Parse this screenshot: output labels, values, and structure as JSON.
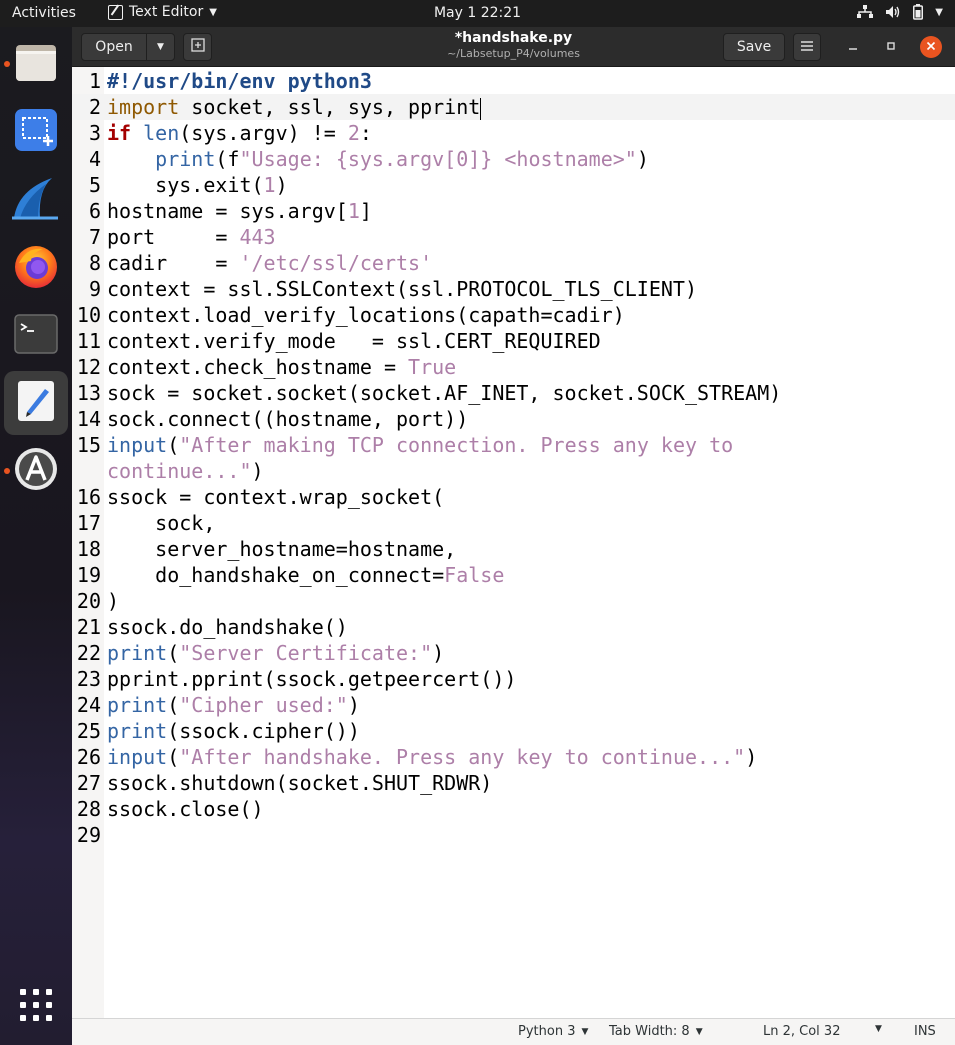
{
  "topbar": {
    "activities": "Activities",
    "app_name": "Text Editor",
    "clock": "May 1  22:21"
  },
  "headerbar": {
    "open_label": "Open",
    "save_label": "Save",
    "title": "*handshake.py",
    "path": "~/Labsetup_P4/volumes"
  },
  "editor": {
    "current_line": 2,
    "lines": [
      {
        "n": "1",
        "tokens": [
          [
            "comment",
            "#!/usr/bin/env python3"
          ]
        ]
      },
      {
        "n": "2",
        "tokens": [
          [
            "import",
            "import"
          ],
          [
            "plain",
            " socket, ssl, sys, pprint"
          ]
        ]
      },
      {
        "n": "3",
        "tokens": [
          [
            "kw",
            "if"
          ],
          [
            "plain",
            " "
          ],
          [
            "builtin",
            "len"
          ],
          [
            "plain",
            "(sys.argv) != "
          ],
          [
            "num",
            "2"
          ],
          [
            "plain",
            ":"
          ]
        ]
      },
      {
        "n": "4",
        "tokens": [
          [
            "plain",
            "    "
          ],
          [
            "builtin",
            "print"
          ],
          [
            "plain",
            "(f"
          ],
          [
            "str",
            "\"Usage: {sys.argv[0]} <hostname>\""
          ],
          [
            "plain",
            ")"
          ]
        ]
      },
      {
        "n": "5",
        "tokens": [
          [
            "plain",
            "    sys.exit("
          ],
          [
            "num",
            "1"
          ],
          [
            "plain",
            ")"
          ]
        ]
      },
      {
        "n": "6",
        "tokens": [
          [
            "plain",
            "hostname = sys.argv["
          ],
          [
            "num",
            "1"
          ],
          [
            "plain",
            "]"
          ]
        ]
      },
      {
        "n": "7",
        "tokens": [
          [
            "plain",
            "port     = "
          ],
          [
            "num",
            "443"
          ]
        ]
      },
      {
        "n": "8",
        "tokens": [
          [
            "plain",
            "cadir    = "
          ],
          [
            "str",
            "'/etc/ssl/certs'"
          ]
        ]
      },
      {
        "n": "9",
        "tokens": [
          [
            "plain",
            "context = ssl.SSLContext(ssl.PROTOCOL_TLS_CLIENT)"
          ]
        ]
      },
      {
        "n": "10",
        "tokens": [
          [
            "plain",
            "context.load_verify_locations(capath=cadir)"
          ]
        ]
      },
      {
        "n": "11",
        "tokens": [
          [
            "plain",
            "context.verify_mode   = ssl.CERT_REQUIRED"
          ]
        ]
      },
      {
        "n": "12",
        "tokens": [
          [
            "plain",
            "context.check_hostname = "
          ],
          [
            "num",
            "True"
          ]
        ]
      },
      {
        "n": "13",
        "tokens": [
          [
            "plain",
            "sock = socket.socket(socket.AF_INET, socket.SOCK_STREAM)"
          ]
        ]
      },
      {
        "n": "14",
        "tokens": [
          [
            "plain",
            "sock.connect((hostname, port))"
          ]
        ]
      },
      {
        "n": "15",
        "tokens": [
          [
            "builtin",
            "input"
          ],
          [
            "plain",
            "("
          ],
          [
            "str",
            "\"After making TCP connection. Press any key to"
          ]
        ]
      },
      {
        "n": "",
        "tokens": [
          [
            "str",
            "continue...\""
          ],
          [
            "plain",
            ")"
          ]
        ]
      },
      {
        "n": "16",
        "tokens": [
          [
            "plain",
            "ssock = context.wrap_socket("
          ]
        ]
      },
      {
        "n": "17",
        "tokens": [
          [
            "plain",
            "    sock,"
          ]
        ]
      },
      {
        "n": "18",
        "tokens": [
          [
            "plain",
            "    server_hostname=hostname,"
          ]
        ]
      },
      {
        "n": "19",
        "tokens": [
          [
            "plain",
            "    do_handshake_on_connect="
          ],
          [
            "num",
            "False"
          ]
        ]
      },
      {
        "n": "20",
        "tokens": [
          [
            "plain",
            ")"
          ]
        ]
      },
      {
        "n": "21",
        "tokens": [
          [
            "plain",
            "ssock.do_handshake()"
          ]
        ]
      },
      {
        "n": "22",
        "tokens": [
          [
            "builtin",
            "print"
          ],
          [
            "plain",
            "("
          ],
          [
            "str",
            "\"Server Certificate:\""
          ],
          [
            "plain",
            ")"
          ]
        ]
      },
      {
        "n": "23",
        "tokens": [
          [
            "plain",
            "pprint.pprint(ssock.getpeercert())"
          ]
        ]
      },
      {
        "n": "24",
        "tokens": [
          [
            "builtin",
            "print"
          ],
          [
            "plain",
            "("
          ],
          [
            "str",
            "\"Cipher used:\""
          ],
          [
            "plain",
            ")"
          ]
        ]
      },
      {
        "n": "25",
        "tokens": [
          [
            "builtin",
            "print"
          ],
          [
            "plain",
            "(ssock.cipher())"
          ]
        ]
      },
      {
        "n": "26",
        "tokens": [
          [
            "builtin",
            "input"
          ],
          [
            "plain",
            "("
          ],
          [
            "str",
            "\"After handshake. Press any key to continue...\""
          ],
          [
            "plain",
            ")"
          ]
        ]
      },
      {
        "n": "27",
        "tokens": [
          [
            "plain",
            "ssock.shutdown(socket.SHUT_RDWR)"
          ]
        ]
      },
      {
        "n": "28",
        "tokens": [
          [
            "plain",
            "ssock.close()"
          ]
        ]
      },
      {
        "n": "29",
        "tokens": []
      }
    ]
  },
  "statusbar": {
    "language": "Python 3",
    "tab_width": "Tab Width: 8",
    "position": "Ln 2, Col 32",
    "mode": "INS"
  },
  "dock": {
    "items": [
      "files-icon",
      "screenshot-icon",
      "wireshark-icon",
      "firefox-icon",
      "terminal-icon",
      "text-editor-icon",
      "software-updater-icon"
    ]
  },
  "colors": {
    "comment": "#204a87",
    "keyword": "#a40000",
    "import": "#8f5902",
    "builtin": "#3465a4",
    "string": "#ad7fa8",
    "close_button": "#e95420"
  }
}
